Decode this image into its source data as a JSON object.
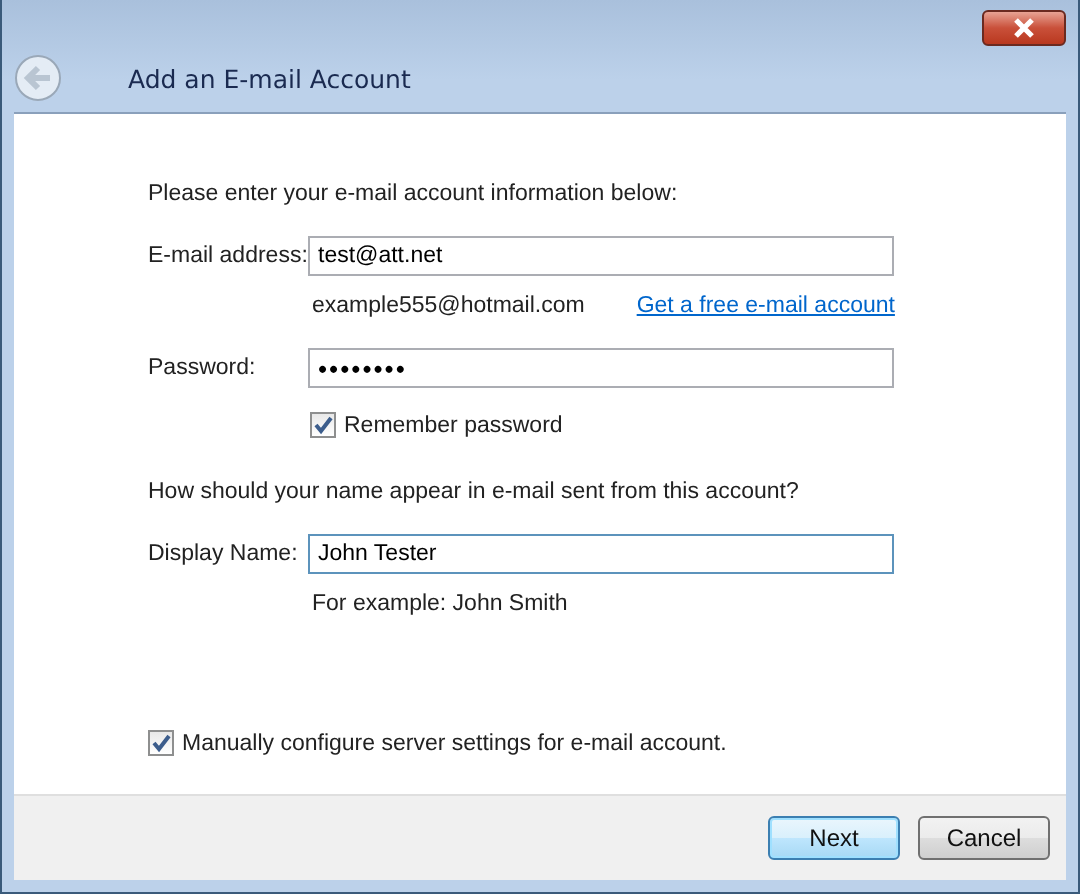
{
  "window": {
    "title": "Add an E-mail Account"
  },
  "intro": "Please enter your e-mail account information below:",
  "email": {
    "label": "E-mail address:",
    "value": "test@att.net",
    "example": "example555@hotmail.com",
    "link": "Get a free e-mail account"
  },
  "password": {
    "label": "Password:",
    "value": "••••••••"
  },
  "remember": {
    "label": "Remember password",
    "checked": true
  },
  "question": "How should your name appear in e-mail sent from this account?",
  "display_name": {
    "label": "Display Name:",
    "value": "John Tester",
    "example": "For example: John Smith"
  },
  "manual": {
    "label": "Manually configure server settings for e-mail account.",
    "checked": true
  },
  "buttons": [
    {
      "label": "Next",
      "default": true
    },
    {
      "label": "Cancel",
      "default": false
    }
  ]
}
